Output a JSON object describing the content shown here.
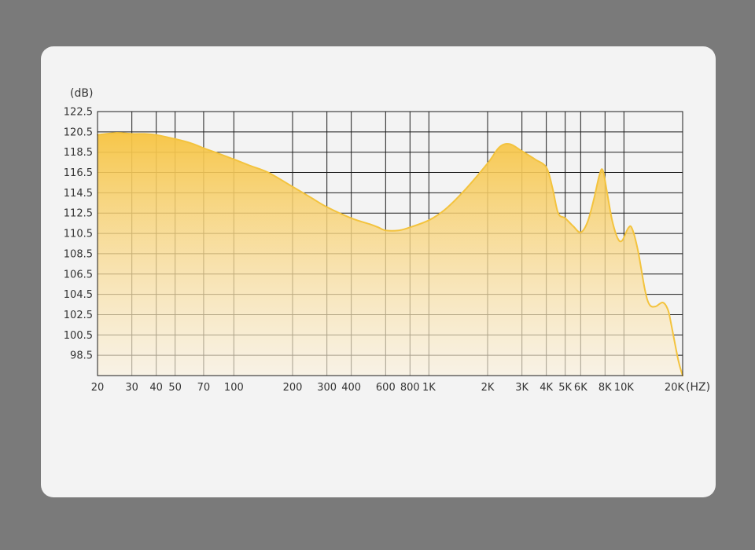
{
  "chart_data": {
    "type": "area",
    "title": "",
    "xlabel": "(HZ)",
    "ylabel": "(dB)",
    "x_scale": "log",
    "xlim": [
      20,
      20000
    ],
    "ylim": [
      96.5,
      122.5
    ],
    "y_ticks": [
      {
        "value": 122.5,
        "label": "122.5"
      },
      {
        "value": 120.5,
        "label": "120.5"
      },
      {
        "value": 118.5,
        "label": "118.5"
      },
      {
        "value": 116.5,
        "label": "116.5"
      },
      {
        "value": 114.5,
        "label": "114.5"
      },
      {
        "value": 112.5,
        "label": "112.5"
      },
      {
        "value": 110.5,
        "label": "110.5"
      },
      {
        "value": 108.5,
        "label": "108.5"
      },
      {
        "value": 106.5,
        "label": "106.5"
      },
      {
        "value": 104.5,
        "label": "104.5"
      },
      {
        "value": 102.5,
        "label": "102.5"
      },
      {
        "value": 100.5,
        "label": "100.5"
      },
      {
        "value": 98.5,
        "label": "98.5"
      }
    ],
    "x_ticks": [
      {
        "value": 20,
        "label": "20"
      },
      {
        "value": 30,
        "label": "30"
      },
      {
        "value": 40,
        "label": "40"
      },
      {
        "value": 50,
        "label": "50"
      },
      {
        "value": 70,
        "label": "70"
      },
      {
        "value": 100,
        "label": "100"
      },
      {
        "value": 200,
        "label": "200"
      },
      {
        "value": 300,
        "label": "300"
      },
      {
        "value": 400,
        "label": "400"
      },
      {
        "value": 600,
        "label": "600"
      },
      {
        "value": 800,
        "label": "800"
      },
      {
        "value": 1000,
        "label": "1K"
      },
      {
        "value": 2000,
        "label": "2K"
      },
      {
        "value": 3000,
        "label": "3K"
      },
      {
        "value": 4000,
        "label": "4K"
      },
      {
        "value": 5000,
        "label": "5K"
      },
      {
        "value": 6000,
        "label": "6K"
      },
      {
        "value": 8000,
        "label": "8K"
      },
      {
        "value": 10000,
        "label": "10K"
      },
      {
        "value": 20000,
        "label": "20K"
      }
    ],
    "grid": true,
    "colors": {
      "line": "#f3c33e",
      "fill_top": "#f7c441",
      "fill_bottom": "#fbf1dc",
      "grid": "#1c1c1c"
    },
    "series": [
      {
        "points": [
          [
            20,
            120.2
          ],
          [
            25,
            120.4
          ],
          [
            30,
            120.3
          ],
          [
            35,
            120.3
          ],
          [
            40,
            120.2
          ],
          [
            50,
            119.8
          ],
          [
            60,
            119.4
          ],
          [
            70,
            118.9
          ],
          [
            80,
            118.5
          ],
          [
            100,
            117.8
          ],
          [
            120,
            117.2
          ],
          [
            150,
            116.5
          ],
          [
            200,
            115.1
          ],
          [
            250,
            114.0
          ],
          [
            300,
            113.1
          ],
          [
            400,
            112.0
          ],
          [
            500,
            111.4
          ],
          [
            550,
            111.1
          ],
          [
            600,
            110.8
          ],
          [
            700,
            110.8
          ],
          [
            800,
            111.1
          ],
          [
            1000,
            111.8
          ],
          [
            1200,
            112.8
          ],
          [
            1500,
            114.6
          ],
          [
            2000,
            117.4
          ],
          [
            2300,
            119.0
          ],
          [
            2600,
            119.3
          ],
          [
            3000,
            118.6
          ],
          [
            3500,
            117.8
          ],
          [
            4000,
            117.0
          ],
          [
            4300,
            115.0
          ],
          [
            4600,
            112.5
          ],
          [
            5000,
            112.0
          ],
          [
            5500,
            111.2
          ],
          [
            6000,
            110.6
          ],
          [
            6500,
            111.6
          ],
          [
            7000,
            113.8
          ],
          [
            7500,
            116.3
          ],
          [
            7800,
            116.7
          ],
          [
            8200,
            114.5
          ],
          [
            8700,
            111.8
          ],
          [
            9300,
            110.0
          ],
          [
            9800,
            109.8
          ],
          [
            10500,
            111.0
          ],
          [
            11000,
            111.0
          ],
          [
            11800,
            108.8
          ],
          [
            12800,
            105.0
          ],
          [
            13500,
            103.5
          ],
          [
            14500,
            103.3
          ],
          [
            15800,
            103.7
          ],
          [
            16800,
            103.0
          ],
          [
            17500,
            101.5
          ],
          [
            19000,
            98.0
          ],
          [
            20000,
            96.5
          ]
        ]
      }
    ]
  }
}
